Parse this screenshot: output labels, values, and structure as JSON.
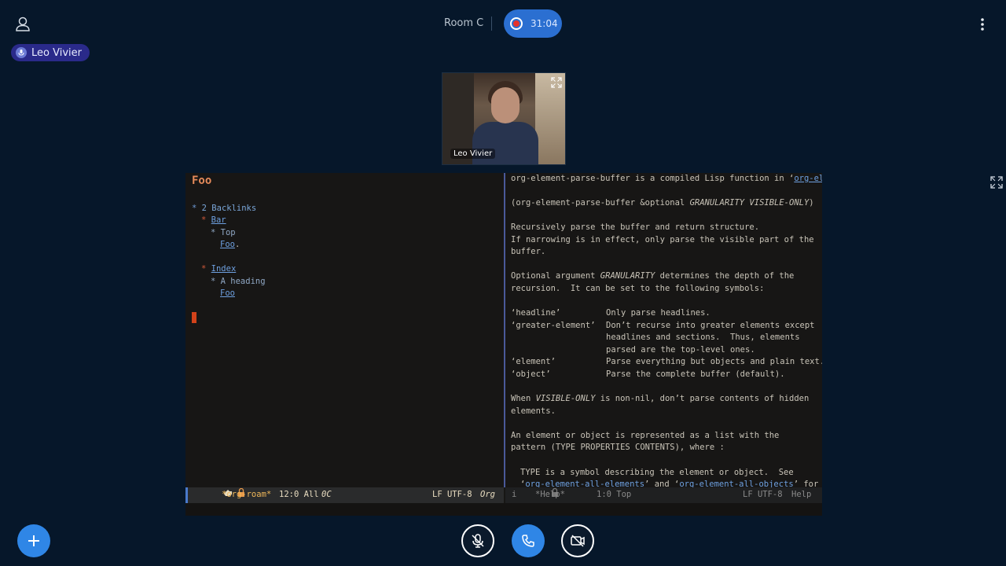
{
  "header": {
    "room_name": "Room C",
    "recording_time": "31:04",
    "speaker_name": "Leo Vivier"
  },
  "video": {
    "participant_name": "Leo Vivier"
  },
  "editor": {
    "left_pane": {
      "title": "Foo",
      "backlinks_star": "*",
      "backlinks_heading": "2 Backlinks",
      "entry1_star": "*",
      "entry1_link": "Bar",
      "entry1_sub_star": "* Top",
      "entry1_ref": "Foo",
      "entry1_ref_suffix": ".",
      "entry2_star": "*",
      "entry2_link": "Index",
      "entry2_sub_star": "* A heading",
      "entry2_ref": "Foo"
    },
    "right_pane": {
      "line1_prefix": "org-element-parse-buffer is a compiled Lisp function in ‘",
      "line1_link": "org-ele",
      "trunc_marker": "→",
      "signature_prefix": "(org-element-parse-buffer &optional ",
      "signature_args": "GRANULARITY VISIBLE-ONLY",
      "signature_suffix": ")",
      "desc1": "Recursively parse the buffer and return structure.",
      "desc2": "If narrowing is in effect, only parse the visible part of the",
      "desc3": "buffer.",
      "opt1_prefix": "Optional argument ",
      "opt1_arg": "GRANULARITY",
      "opt1_suffix": " determines the depth of the",
      "opt2": "recursion.  It can be set to the following symbols:",
      "sym1_name": "‘headline’",
      "sym1_desc": "Only parse headlines.",
      "sym2_name": "‘greater-element’",
      "sym2_desc": "Don’t recurse into greater elements except",
      "sym2_desc2": "headlines and sections.  Thus, elements",
      "sym2_desc3": "parsed are the top-level ones.",
      "sym3_name": "‘element’",
      "sym3_desc": "Parse everything but objects and plain text.",
      "sym4_name": "‘object’",
      "sym4_desc": "Parse the complete buffer (default).",
      "vis_prefix": "When ",
      "vis_arg": "VISIBLE-ONLY",
      "vis_suffix": " is non-nil, don’t parse contents of hidden",
      "vis2": "elements.",
      "rep1": "An element or object is represented as a list with the",
      "rep2": "pattern (TYPE PROPERTIES CONTENTS), where :",
      "type1": "TYPE is a symbol describing the element or object.  See",
      "type2_prefix": "‘",
      "type2_link1": "org-element-all-elements",
      "type2_mid": "’ and ‘",
      "type2_link2": "org-element-all-objects",
      "type2_suffix": "’ for a"
    },
    "modeline_left": {
      "buffer": "*org-roam*",
      "position": "12:0 All",
      "column": "0C",
      "encoding": "LF UTF-8",
      "mode": "Org"
    },
    "modeline_right": {
      "info": "i",
      "buffer": "*Help*",
      "position": "1:0 Top",
      "encoding": "LF UTF-8",
      "mode": "Help"
    }
  },
  "colors": {
    "background": "#06172a",
    "accent_blue": "#2f86e6",
    "record_red": "#e5322b",
    "speaker_chip": "#2a2a8a"
  }
}
